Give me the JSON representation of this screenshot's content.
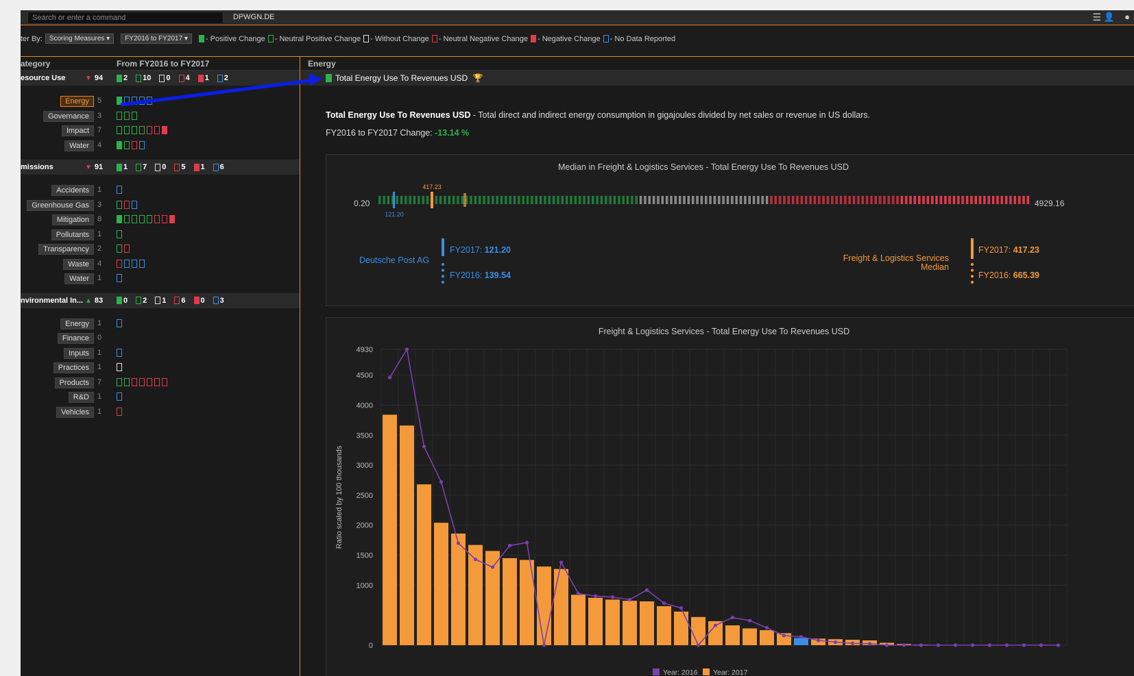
{
  "cmdbar": {
    "search_placeholder": "Search or enter a command",
    "ticker": "DPWGN.DE",
    "menu_icon": "hamburger-menu-icon",
    "user_icon": "user-icon",
    "chat_icon": "chat-icon"
  },
  "filter": {
    "label": "ter By:",
    "measure_select": "Scoring Measures ▾",
    "period_select": "FY2016 to FY2017 ▾",
    "legend": [
      {
        "kind": "pos",
        "label": "- Positive Change"
      },
      {
        "kind": "npos",
        "label": "- Neutral Positive Change"
      },
      {
        "kind": "none",
        "label": "- Without Change"
      },
      {
        "kind": "nneg",
        "label": "- Neutral Negative Change"
      },
      {
        "kind": "neg",
        "label": "- Negative Change"
      },
      {
        "kind": "nodata",
        "label": "- No Data Reported"
      }
    ]
  },
  "left": {
    "col1": "ategory",
    "col2": "From FY2016 to FY2017",
    "categories": [
      {
        "name": "esource Use",
        "trend": "down",
        "score": "94",
        "counts": [
          "2",
          "10",
          "0",
          "4",
          "1",
          "2"
        ],
        "subs": [
          {
            "label": "Energy",
            "count": "5",
            "active": true,
            "bars": [
              "pos",
              "nodata",
              "nodata",
              "nodata",
              "nodata"
            ]
          },
          {
            "label": "Governance",
            "count": "3",
            "bars": [
              "npos",
              "npos",
              "npos"
            ]
          },
          {
            "label": "Impact",
            "count": "7",
            "bars": [
              "npos",
              "npos",
              "npos",
              "npos",
              "nneg",
              "nneg",
              "neg"
            ]
          },
          {
            "label": "Water",
            "count": "4",
            "bars": [
              "pos",
              "npos",
              "nneg",
              "nodata"
            ]
          }
        ]
      },
      {
        "name": "missions",
        "trend": "down",
        "score": "91",
        "counts": [
          "1",
          "7",
          "0",
          "5",
          "1",
          "6"
        ],
        "subs": [
          {
            "label": "Accidents",
            "count": "1",
            "bars": [
              "nodata"
            ]
          },
          {
            "label": "Greenhouse Gas",
            "count": "3",
            "bars": [
              "npos",
              "nneg",
              "nodata"
            ]
          },
          {
            "label": "Mitigation",
            "count": "8",
            "bars": [
              "pos",
              "npos",
              "npos",
              "npos",
              "npos",
              "nneg",
              "nneg",
              "neg"
            ]
          },
          {
            "label": "Pollutants",
            "count": "1",
            "bars": [
              "npos"
            ]
          },
          {
            "label": "Transparency",
            "count": "2",
            "bars": [
              "npos",
              "nneg"
            ]
          },
          {
            "label": "Waste",
            "count": "4",
            "bars": [
              "nneg",
              "nodata",
              "nodata",
              "nodata"
            ]
          },
          {
            "label": "Water",
            "count": "1",
            "bars": [
              "nodata"
            ]
          }
        ]
      },
      {
        "name": "nvironmental In...",
        "trend": "up",
        "score": "83",
        "counts": [
          "0",
          "2",
          "1",
          "6",
          "0",
          "3"
        ],
        "subs": [
          {
            "label": "Energy",
            "count": "1",
            "bars": [
              "nodata"
            ]
          },
          {
            "label": "Finance",
            "count": "0",
            "bars": []
          },
          {
            "label": "Inputs",
            "count": "1",
            "bars": [
              "nodata"
            ]
          },
          {
            "label": "Practices",
            "count": "1",
            "bars": [
              "none"
            ]
          },
          {
            "label": "Products",
            "count": "7",
            "bars": [
              "npos",
              "npos",
              "nneg",
              "nneg",
              "nneg",
              "nneg",
              "nneg"
            ]
          },
          {
            "label": "R&D",
            "count": "1",
            "bars": [
              "nodata"
            ]
          },
          {
            "label": "Vehicles",
            "count": "1",
            "bars": [
              "nneg"
            ]
          }
        ]
      }
    ]
  },
  "right": {
    "header": "Energy",
    "measure_name": "Total Energy Use To Revenues USD",
    "trophy_icon": "trophy-icon",
    "desc_title": "Total Energy Use To Revenues USD",
    "desc_text": " - Total direct and indirect energy consumption in gigajoules divided by net sales or revenue in US dollars.",
    "change_label": "FY2016 to FY2017 Change: ",
    "change_value": "-13.14 %",
    "median": {
      "title": "Median in Freight & Logistics Services - Total Energy Use To Revenues USD",
      "min": "0.20",
      "max": "4929.16",
      "median_marker": "417.23",
      "company_marker": "121.20",
      "company": "Deutsche Post AG",
      "company_fy17_label": "FY2017: ",
      "company_fy17": "121.20",
      "company_fy16_label": "FY2016: ",
      "company_fy16": "139.54",
      "industry_line1": "Freight & Logistics Services",
      "industry_line2": "Median",
      "industry_fy17_label": "FY2017: ",
      "industry_fy17": "417.23",
      "industry_fy16_label": "FY2016: ",
      "industry_fy16": "665.39"
    }
  },
  "colors": {
    "accent": "#e8862c",
    "positive": "#2bb24c",
    "negative": "#e03b4b",
    "nodata": "#3a8ee6",
    "bar2017": "#f49a3a",
    "line2016": "#7b3fb0",
    "highlight": "#3a8ee6"
  },
  "chart_data": {
    "type": "bar",
    "title": "Freight & Logistics Services - Total Energy Use To Revenues USD",
    "ylabel": "Ratio scaled by 100 thousands",
    "yticks": [
      0,
      1000,
      1500,
      2000,
      2500,
      3000,
      3500,
      4000,
      4500,
      4930
    ],
    "ylim": [
      0,
      4930
    ],
    "highlight_index": 24,
    "series": [
      {
        "name": "Year: 2017",
        "kind": "bar",
        "values": [
          3840,
          3660,
          2680,
          2040,
          1860,
          1670,
          1570,
          1450,
          1420,
          1310,
          1270,
          840,
          790,
          760,
          740,
          730,
          650,
          560,
          470,
          400,
          330,
          280,
          250,
          200,
          121,
          110,
          100,
          90,
          80,
          40,
          20,
          10,
          0,
          0,
          0,
          0,
          0,
          0,
          0,
          0
        ]
      },
      {
        "name": "Year: 2016",
        "kind": "line",
        "values": [
          4460,
          4930,
          3310,
          2720,
          1700,
          1430,
          1300,
          1660,
          1710,
          0,
          1380,
          860,
          820,
          800,
          760,
          920,
          700,
          620,
          0,
          330,
          460,
          410,
          290,
          160,
          140,
          80,
          50,
          30,
          25,
          0,
          0,
          0,
          0,
          0,
          0,
          0,
          0,
          0,
          0,
          0
        ]
      }
    ]
  }
}
